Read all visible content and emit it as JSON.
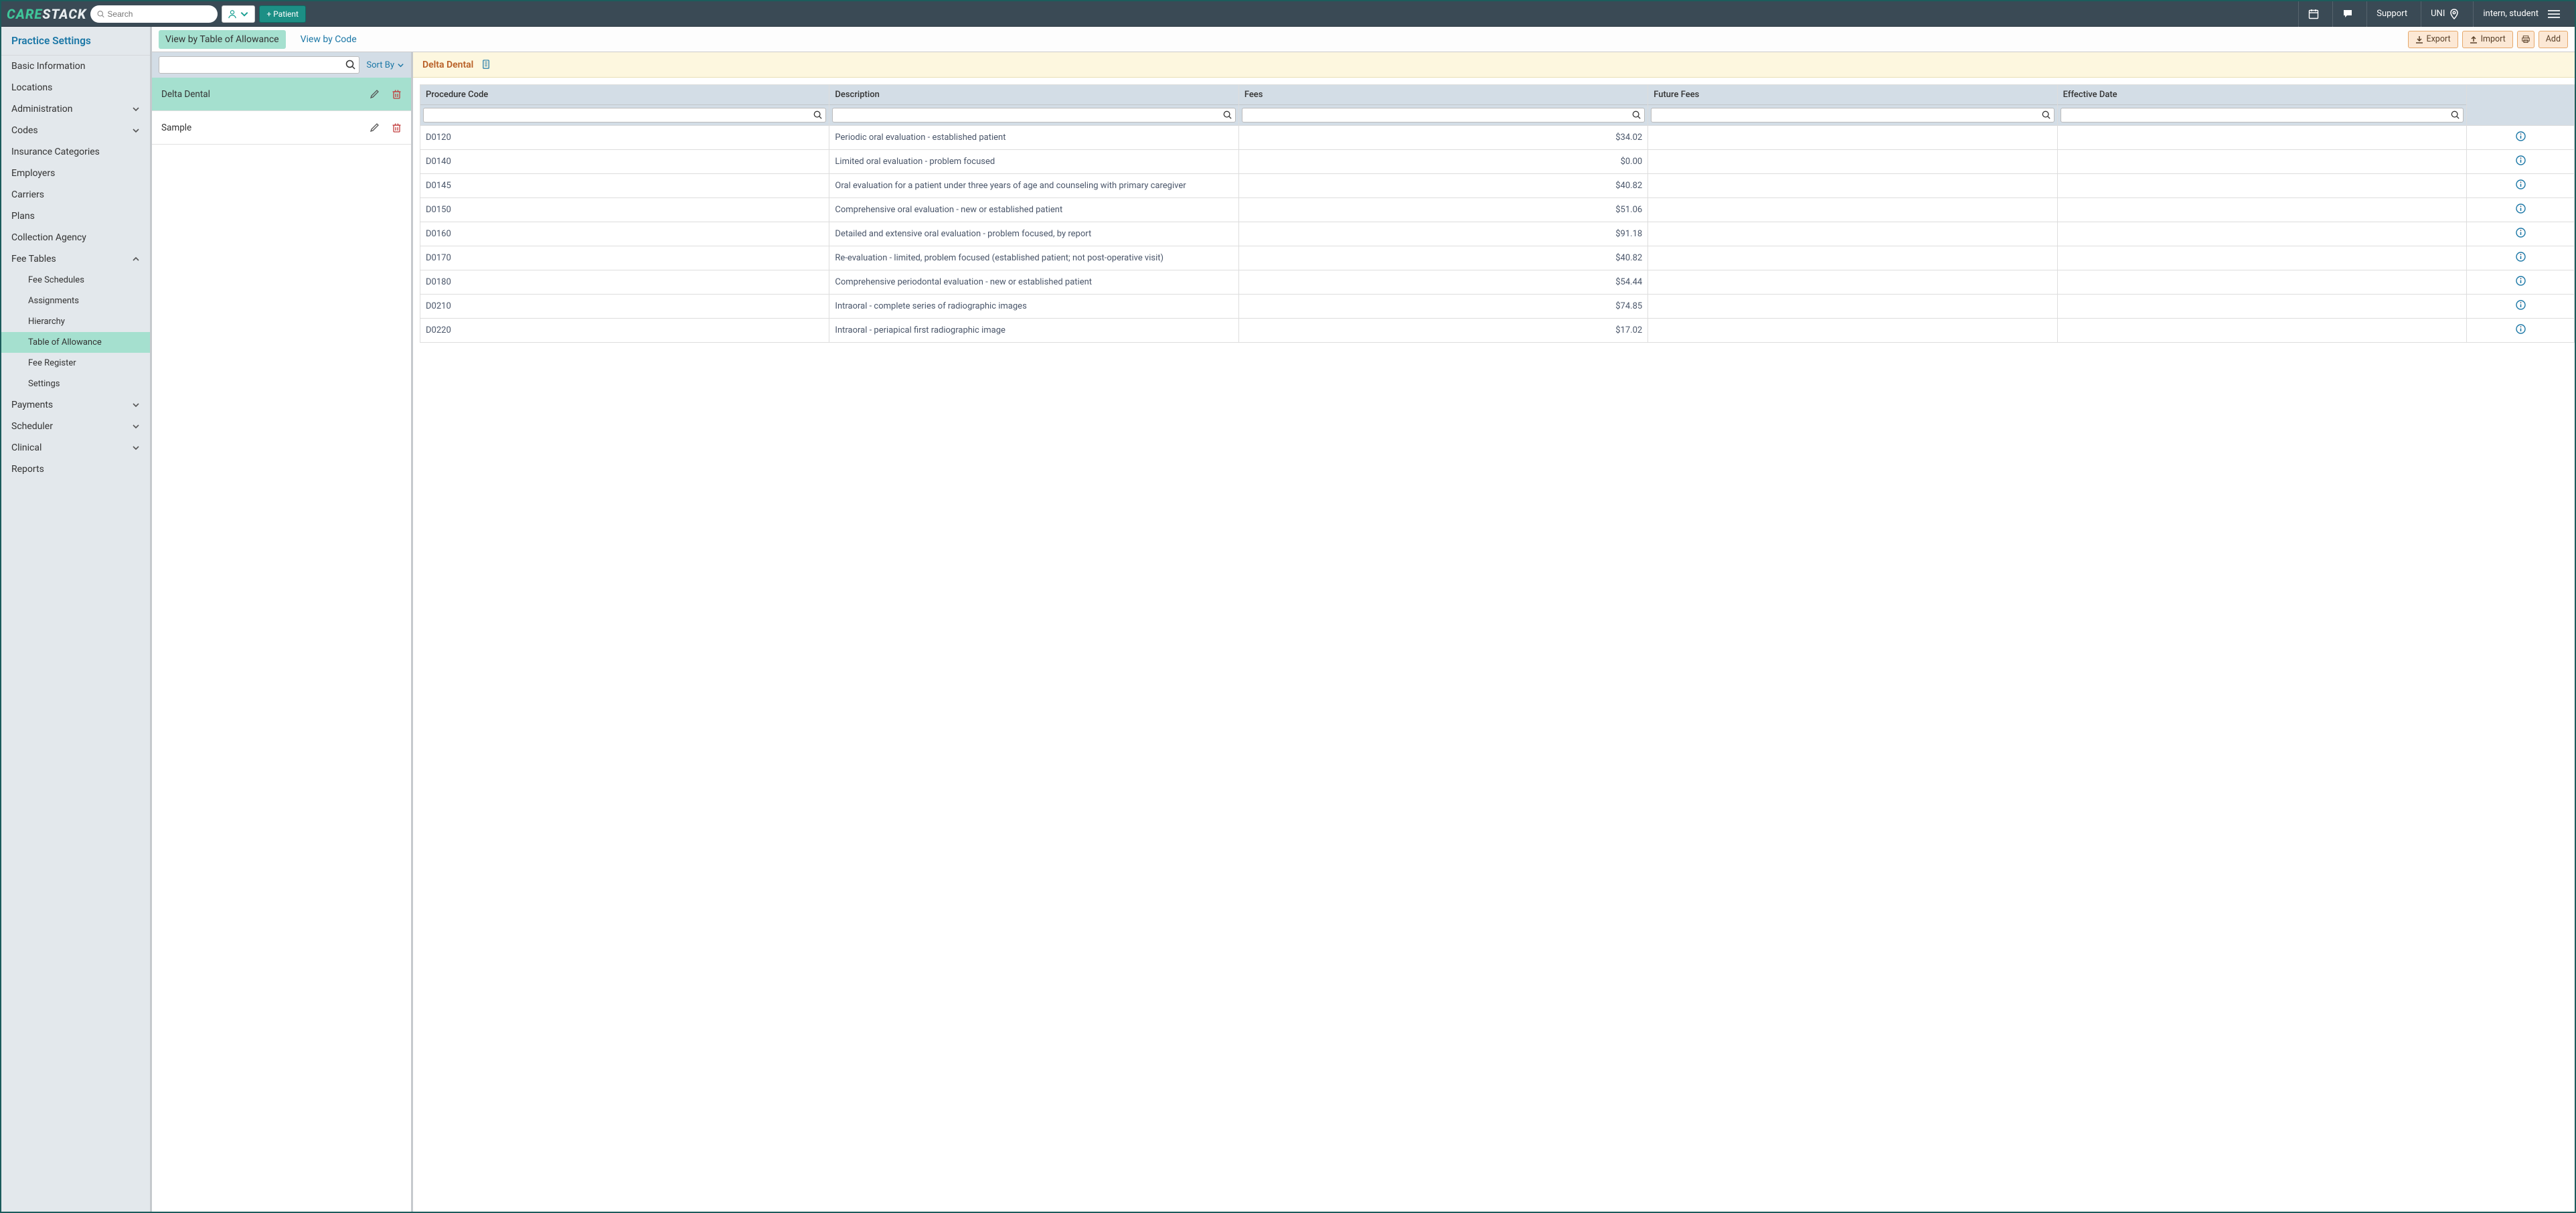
{
  "topnav": {
    "brand1": "CARE",
    "brand2": "STACK",
    "search_placeholder": "Search",
    "add_patient": "+ Patient",
    "support": "Support",
    "location_code": "UNI",
    "user": "intern, student"
  },
  "sidebar": {
    "title": "Practice Settings",
    "items": [
      {
        "label": "Basic Information",
        "expandable": false
      },
      {
        "label": "Locations",
        "expandable": false
      },
      {
        "label": "Administration",
        "expandable": true,
        "expanded": false
      },
      {
        "label": "Codes",
        "expandable": true,
        "expanded": false
      },
      {
        "label": "Insurance Categories",
        "expandable": false
      },
      {
        "label": "Employers",
        "expandable": false
      },
      {
        "label": "Carriers",
        "expandable": false
      },
      {
        "label": "Plans",
        "expandable": false
      },
      {
        "label": "Collection Agency",
        "expandable": false
      },
      {
        "label": "Fee Tables",
        "expandable": true,
        "expanded": true,
        "children": [
          {
            "label": "Fee Schedules"
          },
          {
            "label": "Assignments"
          },
          {
            "label": "Hierarchy"
          },
          {
            "label": "Table of Allowance",
            "active": true
          },
          {
            "label": "Fee Register"
          },
          {
            "label": "Settings"
          }
        ]
      },
      {
        "label": "Payments",
        "expandable": true,
        "expanded": false
      },
      {
        "label": "Scheduler",
        "expandable": true,
        "expanded": false
      },
      {
        "label": "Clinical",
        "expandable": true,
        "expanded": false
      },
      {
        "label": "Reports",
        "expandable": false
      }
    ]
  },
  "toolbar": {
    "tab_allowance": "View by Table of Allowance",
    "tab_code": "View by Code",
    "export": "Export",
    "import": "Import",
    "add": "Add"
  },
  "listPanel": {
    "sort_by": "Sort By",
    "items": [
      {
        "name": "Delta Dental",
        "active": true
      },
      {
        "name": "Sample",
        "active": false
      }
    ]
  },
  "detail": {
    "plan_name": "Delta Dental",
    "columns": {
      "code": "Procedure Code",
      "desc": "Description",
      "fees": "Fees",
      "future_fees": "Future Fees",
      "effective": "Effective Date"
    },
    "rows": [
      {
        "code": "D0120",
        "desc": "Periodic oral evaluation - established patient",
        "fee": "$34.02"
      },
      {
        "code": "D0140",
        "desc": "Limited oral evaluation - problem focused",
        "fee": "$0.00"
      },
      {
        "code": "D0145",
        "desc": "Oral evaluation for a patient under three years of age and counseling with primary caregiver",
        "fee": "$40.82"
      },
      {
        "code": "D0150",
        "desc": "Comprehensive oral evaluation - new or established patient",
        "fee": "$51.06"
      },
      {
        "code": "D0160",
        "desc": "Detailed and extensive oral evaluation - problem focused, by report",
        "fee": "$91.18"
      },
      {
        "code": "D0170",
        "desc": "Re-evaluation - limited, problem focused (established patient; not post-operative visit)",
        "fee": "$40.82"
      },
      {
        "code": "D0180",
        "desc": "Comprehensive periodontal evaluation - new or established patient",
        "fee": "$54.44"
      },
      {
        "code": "D0210",
        "desc": "Intraoral - complete series of radiographic images",
        "fee": "$74.85"
      },
      {
        "code": "D0220",
        "desc": "Intraoral - periapical first radiographic image",
        "fee": "$17.02"
      }
    ]
  }
}
